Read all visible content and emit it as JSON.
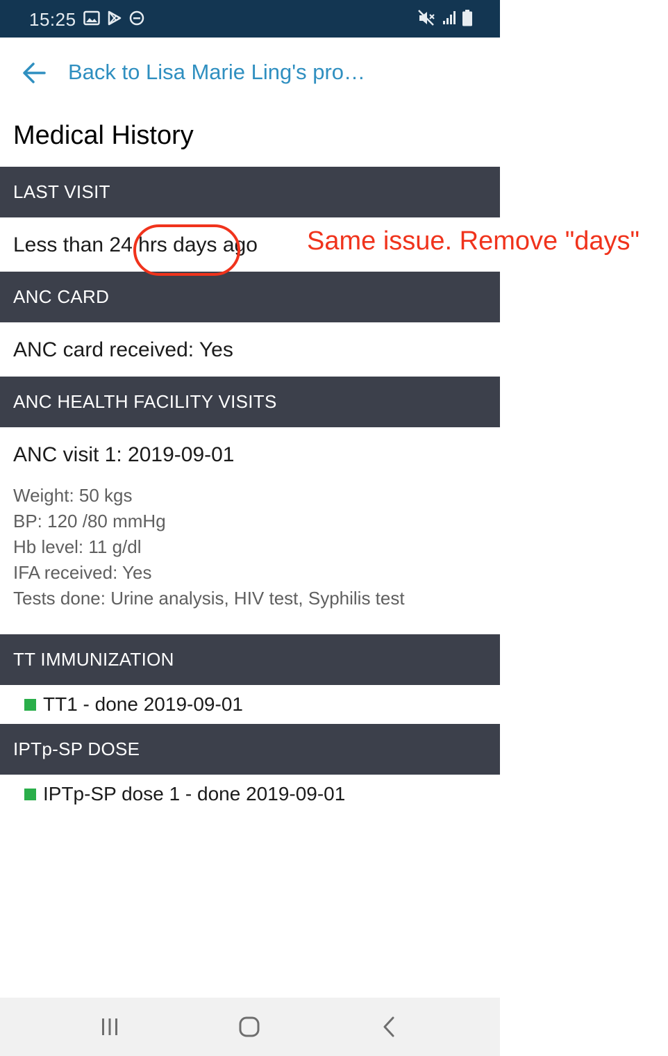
{
  "status_bar": {
    "time": "15:25",
    "left_icons": [
      "image-icon",
      "play-store-icon",
      "do-not-disturb-icon"
    ],
    "right_icons": [
      "mute-icon",
      "signal-icon",
      "battery-icon"
    ]
  },
  "header": {
    "back_label": "Back to Lisa Marie Ling's pro…",
    "title": "Medical History"
  },
  "sections": {
    "last_visit": {
      "header": "LAST VISIT",
      "value": "Less than 24 hrs days ago"
    },
    "anc_card": {
      "header": "ANC CARD",
      "value": "ANC card received: Yes"
    },
    "anc_visits": {
      "header": "ANC HEALTH FACILITY VISITS",
      "visit_title": "ANC visit 1: 2019-09-01",
      "details": [
        "Weight: 50  kgs",
        "BP: 120 /80  mmHg",
        "Hb level: 11  g/dl",
        "IFA received: Yes",
        "Tests done: Urine analysis, HIV test, Syphilis test"
      ]
    },
    "tt_immunization": {
      "header": "TT IMMUNIZATION",
      "item": "TT1 - done 2019-09-01"
    },
    "iptp_sp": {
      "header": "IPTp-SP DOSE",
      "item": "IPTp-SP dose 1 - done 2019-09-01"
    }
  },
  "annotation": {
    "note": "Same issue. Remove \"days\"",
    "color": "#f0331c"
  },
  "colors": {
    "status_bar": "#133652",
    "section_header": "#3c404b",
    "link": "#2f8fc0",
    "done_indicator": "#2aae4a"
  },
  "nav_bar": {
    "icons": [
      "recent-apps-icon",
      "home-icon",
      "back-nav-icon"
    ]
  }
}
